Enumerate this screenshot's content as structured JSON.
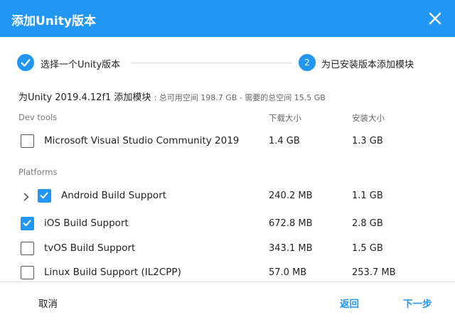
{
  "dialog": {
    "title": "添加Unity版本",
    "close_icon": "close-icon"
  },
  "steps": {
    "step1_label": "选择一个Unity版本",
    "step2_number": "2",
    "step2_label": "为已安装版本添加模块"
  },
  "modules": {
    "heading": "为Unity 2019.4.12f1 添加模块",
    "space_info": ": 总可用空间 198.7 GB - 需要的总空间 15.5 GB"
  },
  "columns": {
    "download_size": "下载大小",
    "install_size": "安装大小"
  },
  "sections": {
    "dev_tools": "Dev tools",
    "platforms": "Platforms"
  },
  "rows": [
    {
      "name": "Microsoft Visual Studio Community 2019",
      "download": "1.4 GB",
      "install": "1.3 GB",
      "checked": false
    },
    {
      "name": "Android Build Support",
      "download": "240.2 MB",
      "install": "1.1 GB",
      "checked": true,
      "expandable": true
    },
    {
      "name": "iOS Build Support",
      "download": "672.8 MB",
      "install": "2.8 GB",
      "checked": true
    },
    {
      "name": "tvOS Build Support",
      "download": "343.1 MB",
      "install": "1.5 GB",
      "checked": false
    },
    {
      "name": "Linux Build Support (IL2CPP)",
      "download": "57.0 MB",
      "install": "253.7 MB",
      "checked": false
    }
  ],
  "footer": {
    "cancel": "取消",
    "back": "返回",
    "next": "下一步"
  },
  "colors": {
    "accent": "#2196f3"
  }
}
